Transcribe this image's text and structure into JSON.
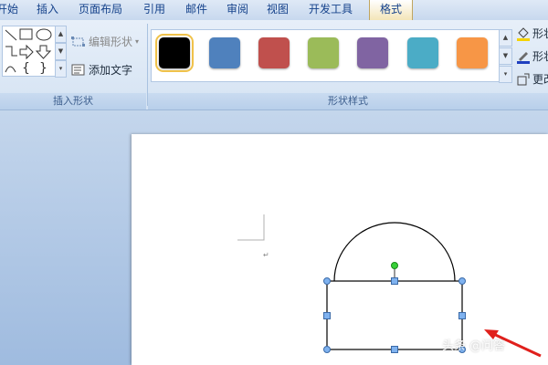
{
  "menu": {
    "tabs": [
      "开始",
      "插入",
      "页面布局",
      "引用",
      "邮件",
      "审阅",
      "视图",
      "开发工具"
    ],
    "active_tab": "格式"
  },
  "ribbon": {
    "insert_shapes": {
      "label": "插入形状",
      "edit_shape": "编辑形状",
      "add_text": "添加文字"
    },
    "shape_styles": {
      "label": "形状样式",
      "swatches": [
        "#000000",
        "#4f81bd",
        "#c0504d",
        "#9bbb59",
        "#8064a2",
        "#4bacc6",
        "#f79646"
      ],
      "right_commands": [
        "形状",
        "形状",
        "更改"
      ]
    }
  },
  "watermark": "头条 @问答"
}
